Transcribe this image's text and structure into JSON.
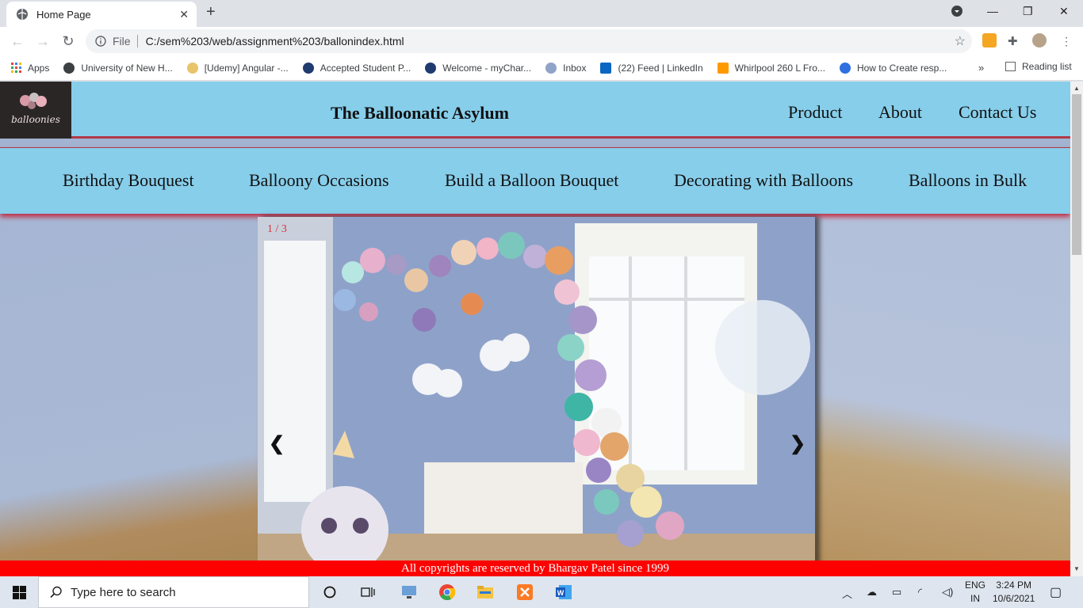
{
  "browser": {
    "tab_title": "Home Page",
    "url_scheme": "File",
    "url": "C:/sem%203/web/assignment%203/ballonindex.html",
    "bookmarks": [
      "Apps",
      "University of New H...",
      "[Udemy] Angular -...",
      "Accepted Student P...",
      "Welcome - myChar...",
      "Inbox",
      "(22) Feed | LinkedIn",
      "Whirlpool 260 L Fro...",
      "How to Create resp..."
    ],
    "bookmarks_more": "»",
    "reading_list": "Reading list"
  },
  "site": {
    "logo_text": "balloonies",
    "title": "The Balloonatic Asylum",
    "top_nav": [
      "Product",
      "About",
      "Contact Us"
    ],
    "sub_nav": [
      "Birthday Bouquest",
      "Balloony Occasions",
      "Build a Balloon Bouquet",
      "Decorating with Balloons",
      "Balloons in Bulk"
    ],
    "slideshow": {
      "counter": "1 / 3",
      "prev": "❮",
      "next": "❯"
    },
    "footer": "All copyrights are reserved by Bhargav Patel since 1999"
  },
  "taskbar": {
    "search_placeholder": "Type here to search",
    "lang_top": "ENG",
    "lang_bottom": "IN",
    "time": "3:24 PM",
    "date": "10/6/2021"
  },
  "colors": {
    "nav_background": "#87ceeb",
    "accent_red": "#ff0000",
    "slide_counter": "#d4333d"
  }
}
